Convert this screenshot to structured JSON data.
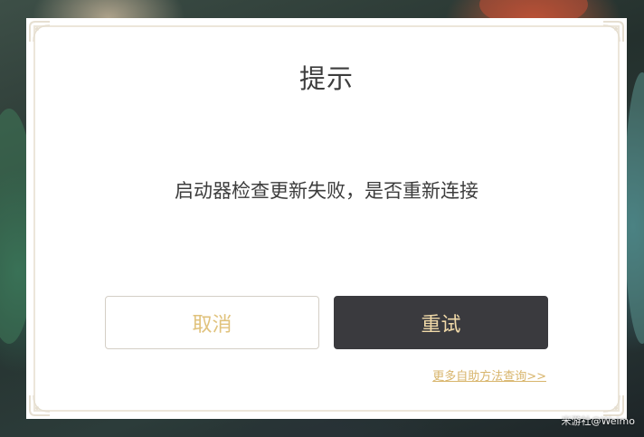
{
  "dialog": {
    "title": "提示",
    "message": "启动器检查更新失败，是否重新连接",
    "cancel_label": "取消",
    "retry_label": "重试",
    "help_link": "更多自助方法查询>>"
  },
  "watermark": "米游社@Weimo",
  "colors": {
    "accent_gold": "#e0c27c",
    "retry_bg": "#3a3a3e",
    "retry_text": "#f0d9a8",
    "link": "#d8b56c",
    "frame": "#ece6da"
  },
  "icons": {
    "corner": "ornament-corner-icon"
  }
}
